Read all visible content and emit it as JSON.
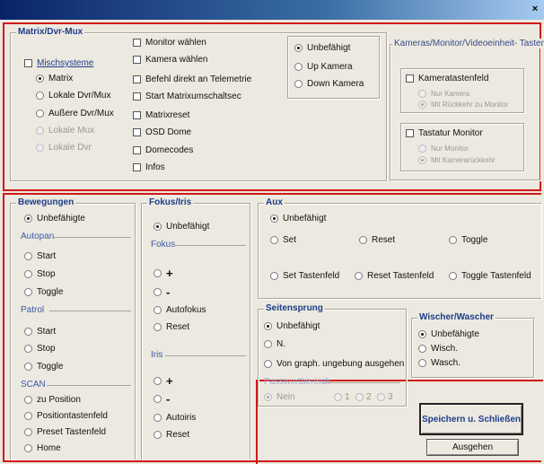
{
  "window": {
    "close_glyph": "×"
  },
  "matrix": {
    "title": "Matrix/Dvr-Mux",
    "mischsysteme": "Mischsysteme",
    "radios": [
      "Matrix",
      "Lokale Dvr/Mux",
      "Außere Dvr/Mux",
      "Lokale Mux",
      "Lokale Dvr"
    ],
    "checks": [
      "Monitor wählen",
      "Kamera wählen",
      "Befehl direkt an Telemetrie",
      "Start Matrixumschaltsec",
      "Matrixreset",
      "OSD Dome",
      "Domecodes",
      "Infos"
    ],
    "cam_radios": [
      "Unbefähigt",
      "Up Kamera",
      "Down Kamera"
    ]
  },
  "kameras": {
    "title": "Kameras/Monitor/Videoeinheit- Tastenfe",
    "kamera_check": "Kameratastenfeld",
    "kamera_opts": [
      "Nur Kamera",
      "Mit Rückkehr zu Monitor"
    ],
    "monitor_check": "Tastatur Monitor",
    "monitor_opts": [
      "Nur Monitor",
      "Mit Kamerarückkehr"
    ]
  },
  "bewegungen": {
    "title": "Bewegungen",
    "unbefaehigte": "Unbefähigte",
    "autopan_label": "Autopan",
    "autopan": [
      "Start",
      "Stop",
      "Toggle"
    ],
    "patrol_label": "Patrol",
    "patrol": [
      "Start",
      "Stop",
      "Toggle"
    ],
    "scan_label": "SCAN",
    "scan": [
      "zu Position",
      "Positiontastenfeld",
      "Preset Tastenfeld",
      "Home"
    ]
  },
  "fokus": {
    "title": "Fokus/Iris",
    "unbefaehigt": "Unbefähigt",
    "fokus_label": "Fokus",
    "plus": "+",
    "minus": "-",
    "autofokus": "Autofokus",
    "reset": "Reset",
    "iris_label": "Iris",
    "autoiris": "Autoiris",
    "reset2": "Reset"
  },
  "aux": {
    "title": "Aux",
    "unbefaehigt": "Unbefähigt",
    "set": "Set",
    "reset": "Reset",
    "toggle": "Toggle",
    "set_tf": "Set Tastenfeld",
    "reset_tf": "Reset Tastenfeld",
    "toggle_tf": "Toggle Tastenfeld"
  },
  "seitensprung": {
    "title": "Seitensprung",
    "unbefaehigt": "Unbefähigt",
    "n": "N.",
    "von": "Von graph. ungebung ausgehen",
    "passwort_label": "Passwortbereich",
    "nein": "Nein",
    "levels": [
      "1",
      "2",
      "3"
    ]
  },
  "wischer": {
    "title": "Wischer/Wascher",
    "opts": [
      "Unbefähigte",
      "Wisch.",
      "Wasch."
    ]
  },
  "buttons": {
    "save": "Speichern u. Schließen",
    "exit": "Ausgehen"
  }
}
